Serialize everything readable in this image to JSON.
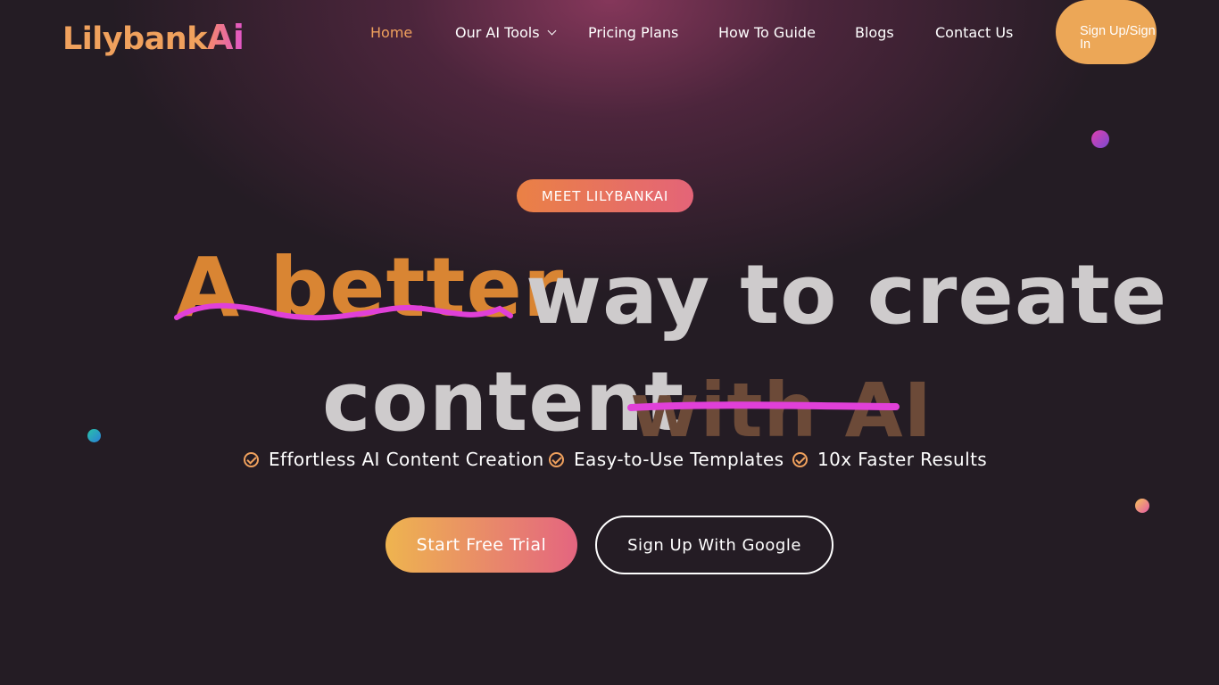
{
  "brand": {
    "logo_word": "Lilybank",
    "logo_ai": "Ai"
  },
  "nav": {
    "items": [
      {
        "label": "Home",
        "active": true
      },
      {
        "label": "Our AI Tools",
        "has_dropdown": true
      },
      {
        "label": "Pricing Plans"
      },
      {
        "label": "How To Guide"
      },
      {
        "label": "Blogs"
      },
      {
        "label": "Contact Us"
      }
    ],
    "signup_label": "Sign Up/Sign In"
  },
  "hero": {
    "badge": "MEET LILYBANKAI",
    "headline": {
      "highlight": "A better",
      "rest_line1": "way to create",
      "line2": "content",
      "struck": "with AI"
    },
    "features": [
      "Effortless AI Content Creation",
      "Easy-to-Use Templates",
      "10x Faster Results"
    ],
    "cta_primary": "Start Free Trial",
    "cta_secondary": "Sign Up With Google"
  },
  "colors": {
    "background": "#241c24",
    "accent_orange": "#f0a15d",
    "accent_pink": "#e040d8",
    "button_orange": "#eca757"
  }
}
